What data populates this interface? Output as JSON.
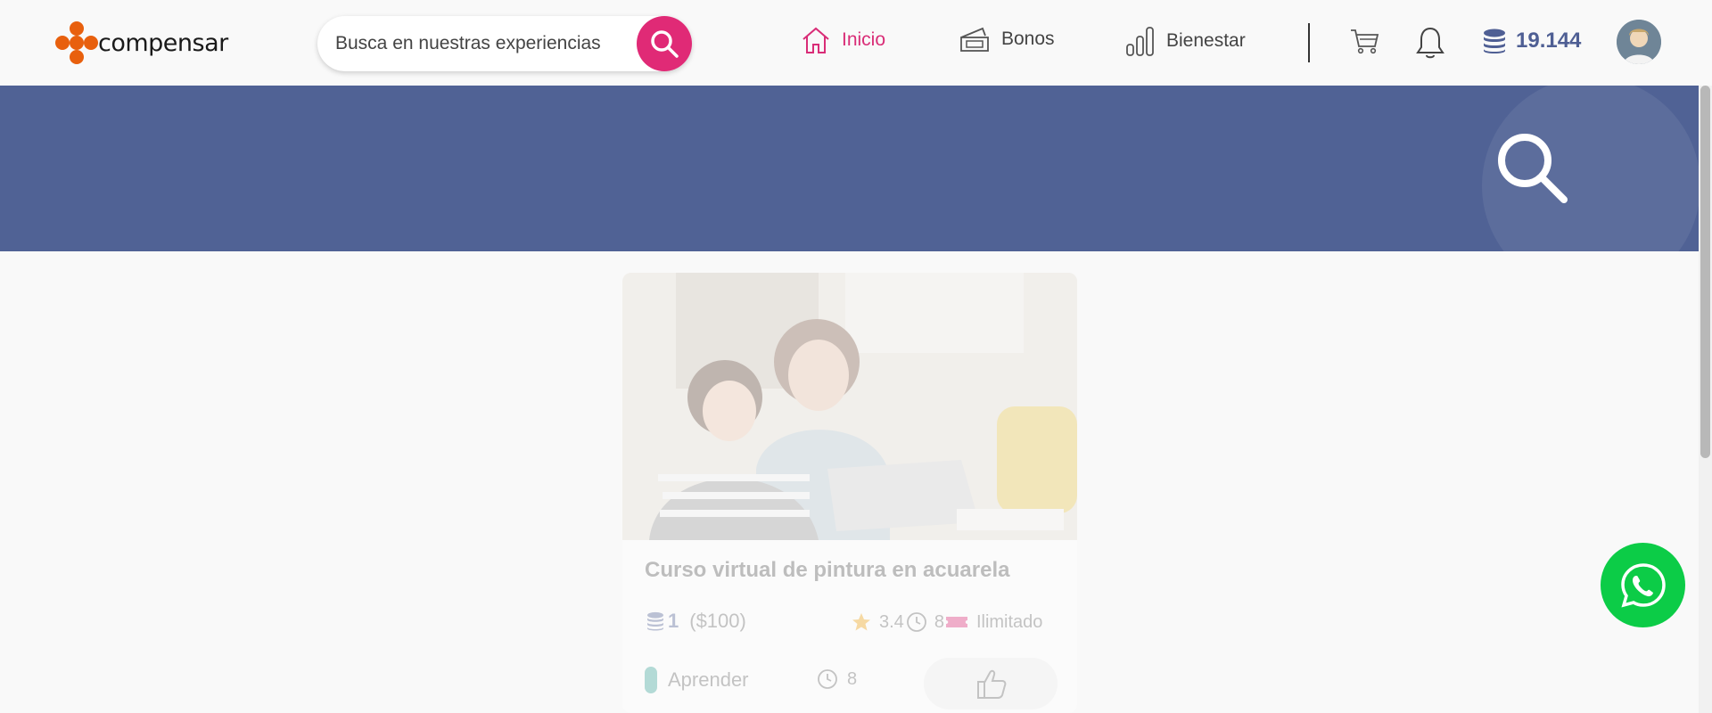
{
  "header": {
    "logo_text": "compensar",
    "search": {
      "placeholder": "Busca en nuestras experiencias"
    },
    "nav": [
      {
        "label": "Inicio",
        "icon": "home-icon",
        "active": true
      },
      {
        "label": "Bonos",
        "icon": "voucher-icon",
        "active": false
      },
      {
        "label": "Bienestar",
        "icon": "bar-chart-icon",
        "active": false
      }
    ],
    "points": "19.144"
  },
  "colors": {
    "brand_orange": "#e8600e",
    "accent_pink": "#e02a76",
    "banner_blue": "#506295",
    "points_blue": "#4f5f94",
    "whatsapp_green": "#0ccc47"
  },
  "card": {
    "title": "Curso virtual de pintura en acuarela",
    "coins": "1",
    "price": "($100)",
    "rating": "3.4",
    "duration": "8",
    "availability": "Ilimitado",
    "category": "Aprender",
    "duration_secondary": "8"
  }
}
